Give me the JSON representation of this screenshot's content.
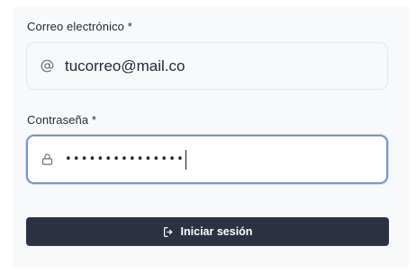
{
  "form": {
    "email": {
      "label": "Correo electrónico *",
      "value": "tucorreo@mail.co",
      "icon": "at-icon"
    },
    "password": {
      "label": "Contraseña *",
      "masked_value": "•••••••••••••••",
      "icon": "lock-icon"
    },
    "submit": {
      "label": "Iniciar sesión",
      "icon": "login-icon"
    }
  },
  "colors": {
    "button_bg": "#2c3242",
    "focus_border": "#7b94c7",
    "panel_bg": "#f8f9fa"
  }
}
